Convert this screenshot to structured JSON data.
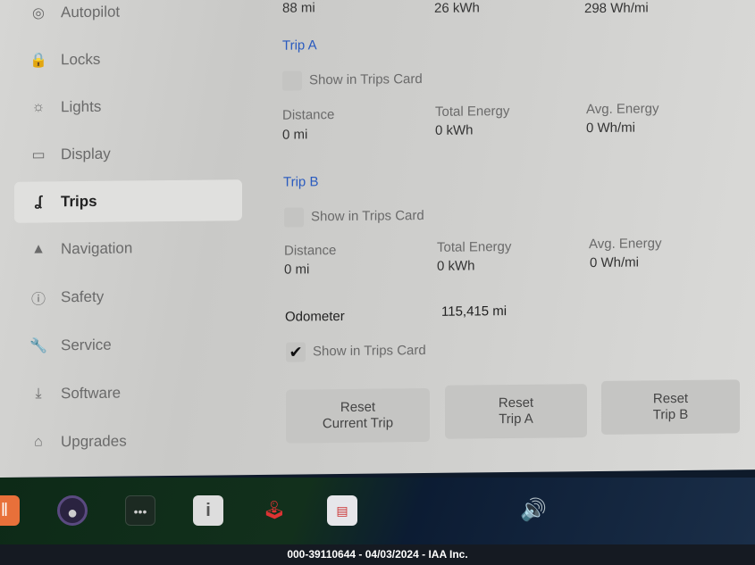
{
  "sidebar": {
    "items": [
      {
        "label": "Autopilot",
        "icon": "steering-wheel-icon",
        "glyph": "◎"
      },
      {
        "label": "Locks",
        "icon": "lock-icon",
        "glyph": "🔒"
      },
      {
        "label": "Lights",
        "icon": "sun-icon",
        "glyph": "☼"
      },
      {
        "label": "Display",
        "icon": "display-icon",
        "glyph": "▭"
      },
      {
        "label": "Trips",
        "icon": "trips-icon",
        "glyph": "ʆ"
      },
      {
        "label": "Navigation",
        "icon": "navigation-icon",
        "glyph": "▲"
      },
      {
        "label": "Safety",
        "icon": "safety-icon",
        "glyph": "ⓘ"
      },
      {
        "label": "Service",
        "icon": "wrench-icon",
        "glyph": "🔧"
      },
      {
        "label": "Software",
        "icon": "download-icon",
        "glyph": "⤓"
      },
      {
        "label": "Upgrades",
        "icon": "bag-icon",
        "glyph": "⌂"
      }
    ],
    "active": "Trips"
  },
  "current": {
    "distance": "88 mi",
    "energy": "26 kWh",
    "avg": "298 Wh/mi"
  },
  "tripA": {
    "title": "Trip A",
    "show": "Show in Trips Card",
    "checked": false,
    "distance_label": "Distance",
    "distance": "0 mi",
    "energy_label": "Total Energy",
    "energy": "0 kWh",
    "avg_label": "Avg. Energy",
    "avg": "0 Wh/mi"
  },
  "tripB": {
    "title": "Trip B",
    "show": "Show in Trips Card",
    "checked": false,
    "distance_label": "Distance",
    "distance": "0 mi",
    "energy_label": "Total Energy",
    "energy": "0 kWh",
    "avg_label": "Avg. Energy",
    "avg": "0 Wh/mi"
  },
  "odometer": {
    "label": "Odometer",
    "value": "115,415 mi",
    "show": "Show in Trips Card",
    "checked": true,
    "check": "✔"
  },
  "buttons": {
    "reset_current": "Reset\nCurrent Trip",
    "reset_a": "Reset\nTrip A",
    "reset_b": "Reset\nTrip B"
  },
  "dock": [
    "audio-icon",
    "camera-icon",
    "more-icon",
    "manual-icon",
    "joystick-icon",
    "calendar-icon"
  ],
  "volume": "🔊",
  "footer": "000-39110644 - 04/03/2024 - IAA Inc."
}
